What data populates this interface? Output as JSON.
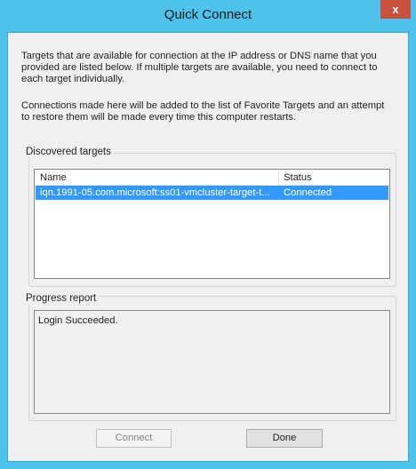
{
  "window": {
    "title": "Quick Connect",
    "close_glyph": "x"
  },
  "intro": {
    "paragraph1": "Targets that are available for connection at the IP address or DNS name that you provided are listed below.  If multiple targets are available, you need to connect to each target individually.",
    "paragraph2": "Connections made here will be added to the list of Favorite Targets and an attempt to restore them will be made every time this computer restarts."
  },
  "discovered": {
    "label": "Discovered targets",
    "columns": {
      "name": "Name",
      "status": "Status"
    },
    "rows": [
      {
        "name": "iqn.1991-05.com.microsoft:ss01-vmcluster-target-t...",
        "status": "Connected",
        "selected": true
      }
    ]
  },
  "progress": {
    "label": "Progress report",
    "text": "Login Succeeded."
  },
  "buttons": {
    "connect": "Connect",
    "done": "Done"
  },
  "colors": {
    "frame": "#4ec2ea",
    "close": "#c7503f",
    "selection": "#3399ff"
  }
}
